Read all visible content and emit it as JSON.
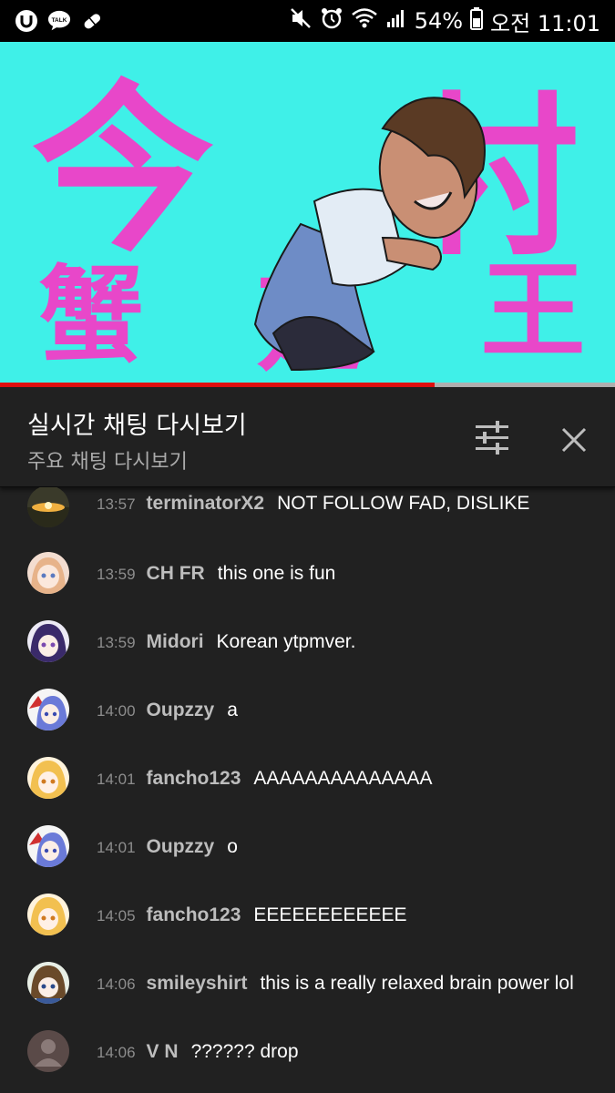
{
  "status_bar": {
    "battery_percent": "54%",
    "time": "오전 11:01",
    "talk_label": "TALK"
  },
  "video": {
    "progress_fraction": 0.707,
    "overlay_chars": [
      "今",
      "村",
      "蟹",
      "廻",
      "王"
    ],
    "colors": {
      "background": "#3ff0e8",
      "text": "#e847c9"
    }
  },
  "panel": {
    "title": "실시간 채팅 다시보기",
    "subtitle": "주요 채팅 다시보기",
    "filter_icon": "sliders-icon",
    "close_icon": "close-icon"
  },
  "messages": [
    {
      "time": "13:57",
      "author": "terminatorX2",
      "text": "NOT FOLLOW FAD, DISLIKE",
      "avatar": "sunset"
    },
    {
      "time": "13:59",
      "author": "CH FR",
      "text": "this one is fun",
      "avatar": "anime-peach"
    },
    {
      "time": "13:59",
      "author": "Midori",
      "text": "Korean ytpmver.",
      "avatar": "anime-purple"
    },
    {
      "time": "14:00",
      "author": "Oupzzy",
      "text": "a",
      "avatar": "anime-blue"
    },
    {
      "time": "14:01",
      "author": "fancho123",
      "text": "AAAAAAAAAAAAAA",
      "avatar": "anime-blonde"
    },
    {
      "time": "14:01",
      "author": "Oupzzy",
      "text": "o",
      "avatar": "anime-blue"
    },
    {
      "time": "14:05",
      "author": "fancho123",
      "text": "EEEEEEEEEEEE",
      "avatar": "anime-blonde"
    },
    {
      "time": "14:06",
      "author": "smileyshirt",
      "text": "this is a really relaxed brain power lol",
      "avatar": "anime-brown"
    },
    {
      "time": "14:06",
      "author": "V N",
      "text": "?????? drop",
      "avatar": "default-user"
    }
  ]
}
